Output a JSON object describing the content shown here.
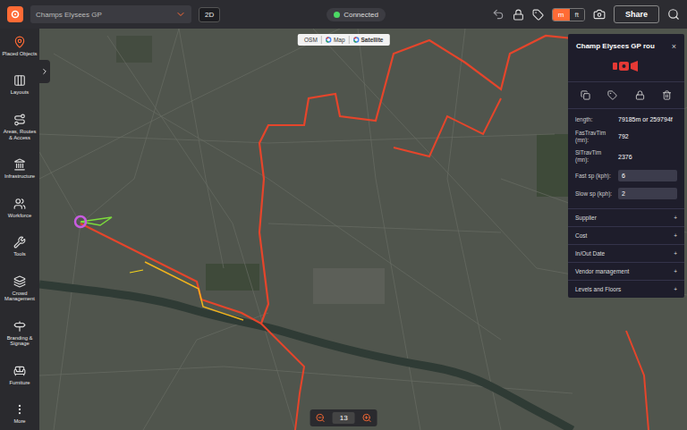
{
  "topbar": {
    "project": "Champs Elysees GP",
    "view": "2D",
    "status": {
      "label": "Connected",
      "connected": true
    },
    "units": [
      {
        "label": "m",
        "selected": true
      },
      {
        "label": "ft",
        "selected": false
      }
    ],
    "share": "Share"
  },
  "sidebar": {
    "items": [
      {
        "label": "Placed Objects",
        "selected": true
      },
      {
        "label": "Layouts",
        "selected": false
      },
      {
        "label": "Areas, Routes & Access",
        "selected": false
      },
      {
        "label": "Infrastructure",
        "selected": false
      },
      {
        "label": "Workforce",
        "selected": false
      },
      {
        "label": "Tools",
        "selected": false
      },
      {
        "label": "Crowd Management",
        "selected": false
      },
      {
        "label": "Branding & Signage",
        "selected": false
      },
      {
        "label": "Furniture",
        "selected": false
      },
      {
        "label": "More",
        "selected": false
      }
    ]
  },
  "map": {
    "sources": [
      {
        "label": "OSM",
        "selected": false
      },
      {
        "label": "Map",
        "selected": false
      },
      {
        "label": "Satellite",
        "selected": true
      }
    ],
    "zoom": "13"
  },
  "panel": {
    "title": "Champ Elysees GP rou",
    "close": "×",
    "properties": [
      {
        "label": "length:",
        "value": "79185m or 259794f",
        "kind": "text"
      },
      {
        "label": "FasTravTim (mn):",
        "value": "792",
        "kind": "text"
      },
      {
        "label": "SlTravTim (mn):",
        "value": "2376",
        "kind": "text"
      },
      {
        "label": "Fast sp (kph):",
        "value": "6",
        "kind": "input"
      },
      {
        "label": "Slow sp (kph):",
        "value": "2",
        "kind": "input"
      }
    ],
    "sections": [
      {
        "label": "Supplier",
        "expand": "+"
      },
      {
        "label": "Cost",
        "expand": "+"
      },
      {
        "label": "In/Out Date",
        "expand": "+"
      },
      {
        "label": "Vendor management",
        "expand": "+"
      },
      {
        "label": "Levels and Floors",
        "expand": "+"
      }
    ]
  }
}
